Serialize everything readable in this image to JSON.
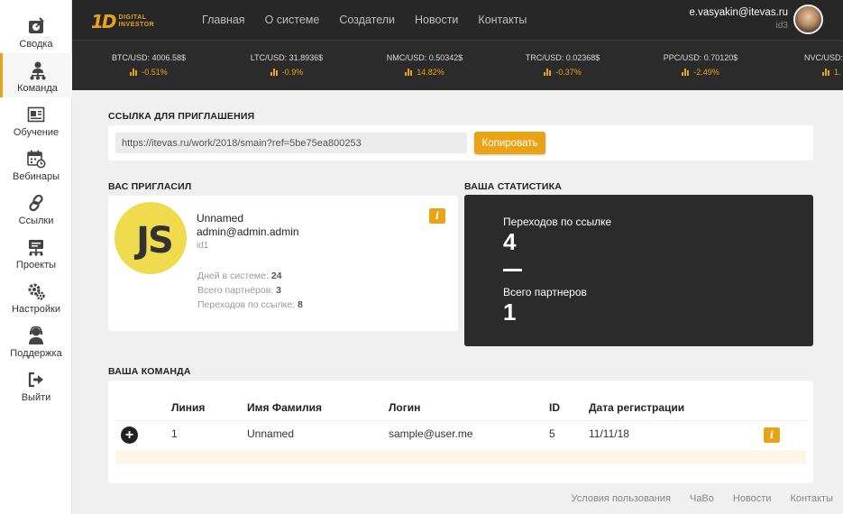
{
  "sidebar": {
    "items": [
      {
        "label": "Сводка",
        "icon": "dashboard-icon"
      },
      {
        "label": "Команда",
        "icon": "team-icon"
      },
      {
        "label": "Обучение",
        "icon": "education-icon"
      },
      {
        "label": "Вебинары",
        "icon": "calendar-icon"
      },
      {
        "label": "Ссылки",
        "icon": "link-icon"
      },
      {
        "label": "Проекты",
        "icon": "projects-icon"
      },
      {
        "label": "Настройки",
        "icon": "gear-icon"
      },
      {
        "label": "Поддержка",
        "icon": "support-icon"
      },
      {
        "label": "Выйти",
        "icon": "logout-icon"
      }
    ],
    "active": "Команда"
  },
  "header": {
    "logo_mark": "1D",
    "logo_line1": "DIGITAL",
    "logo_line2": "INVESTOR",
    "nav": [
      "Главная",
      "О системе",
      "Создатели",
      "Новости",
      "Контакты"
    ],
    "user_email": "e.vasyakin@itevas.ru",
    "user_id": "id3"
  },
  "ticker": [
    {
      "pair": "BTC/USD: 4006.58$",
      "change": "-0.51%"
    },
    {
      "pair": "LTC/USD: 31.8936$",
      "change": "-0.9%"
    },
    {
      "pair": "NMC/USD: 0.50342$",
      "change": "14.82%"
    },
    {
      "pair": "TRC/USD: 0.02368$",
      "change": "-0.37%"
    },
    {
      "pair": "PPC/USD: 0.70120$",
      "change": "-2.49%"
    },
    {
      "pair": "NVC/USD:",
      "change": "1."
    }
  ],
  "invite": {
    "title": "ССЫЛКА ДЛЯ ПРИГЛАШЕНИЯ",
    "link": "https://itevas.ru/work/2018/smain?ref=5be75ea800253",
    "copy_label": "Копировать"
  },
  "inviter": {
    "title": "ВАС ПРИГЛАСИЛ",
    "avatar_text": "JS",
    "name": "Unnamed",
    "email": "admin@admin.admin",
    "id": "id1",
    "days_label": "Дней в системе:",
    "days": "24",
    "partners_label": "Всего партнёров:",
    "partners": "3",
    "clicks_label": "Переходов по ссылке:",
    "clicks": "8",
    "info": "i"
  },
  "stats": {
    "title": "ВАША СТАТИСТИКА",
    "clicks_label": "Переходов по ссылке",
    "clicks": "4",
    "partners_label": "Всего партнеров",
    "partners": "1"
  },
  "team": {
    "title": "ВАША КОМАНДА",
    "columns": [
      "Линия",
      "Имя Фамилия",
      "Логин",
      "ID",
      "Дата регистрации"
    ],
    "rows": [
      {
        "expand": "+",
        "line": "1",
        "name": "Unnamed",
        "login": "sample@user.me",
        "id": "5",
        "date": "11/11/18",
        "info": "i"
      }
    ]
  },
  "footer": {
    "links": [
      "Условия пользования",
      "ЧаВо",
      "Новости",
      "Контакты"
    ]
  },
  "colors": {
    "accent": "#e8a317",
    "dark": "#2b2b2b",
    "js_yellow": "#f0db4f"
  }
}
